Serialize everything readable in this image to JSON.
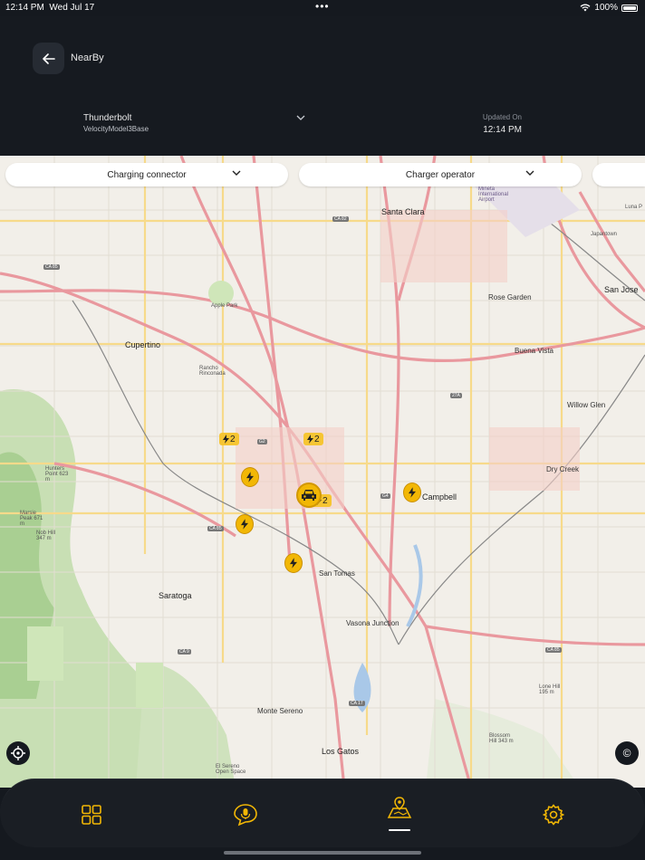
{
  "status_bar": {
    "time": "12:14 PM",
    "date": "Wed Jul 17",
    "dots": "•••",
    "battery": "100%"
  },
  "header": {
    "title": "NearBy",
    "vehicle_name": "Thunderbolt",
    "vehicle_model": "VelocityModel3Base",
    "updated_label": "Updated On",
    "updated_time": "12:14 PM"
  },
  "filters": {
    "charging_connector": "Charging connector",
    "charger_operator": "Charger operator"
  },
  "map": {
    "places": {
      "santa_clara": "Santa Clara",
      "cupertino": "Cupertino",
      "campbell": "Campbell",
      "san_tomas": "San Tomas",
      "saratoga": "Saratoga",
      "vasona_junction": "Vasona Junction",
      "monte_sereno": "Monte Sereno",
      "los_gatos": "Los Gatos",
      "rose_garden": "Rose Garden",
      "buena_vista": "Buena Vista",
      "willow_glen": "Willow Glen",
      "dry_creek": "Dry Creek",
      "san_jose": "San Jose",
      "japantown": "Japantown",
      "luna_park": "Luna P",
      "apple_park": "Apple Park",
      "rancho_rinconada": "Rancho Rinconada",
      "hunters_point": "Hunters Point 623 m",
      "marsie_peak": "Marsie Peak 671 m",
      "nob_hill": "Nob Hill 347 m",
      "lone_hill": "Lone Hill 195 m",
      "blossom_hill": "Blossom Hill 343 m",
      "el_sereno": "El Sereno Open Space",
      "mineta_airport": "Mineta International Airport"
    },
    "highways": {
      "ca82": "CA 82",
      "ca85_nw": "CA 85",
      "ca85_mid": "CA 85",
      "ca85_se": "CA 85",
      "ca9": "CA 9",
      "ca17": "CA 17",
      "g2": "G2",
      "g4": "G4",
      "ca_27a": "27A"
    },
    "charger_counts": {
      "cluster_west": "2",
      "cluster_north": "2",
      "cluster_car": "2"
    },
    "attribution_symbol": "©"
  },
  "tabs": [
    "dashboard",
    "voice-assistant",
    "map-nearby",
    "settings"
  ],
  "colors": {
    "accent": "#F2B705",
    "background": "#15191F",
    "map_bg": "#F2EFE9"
  }
}
